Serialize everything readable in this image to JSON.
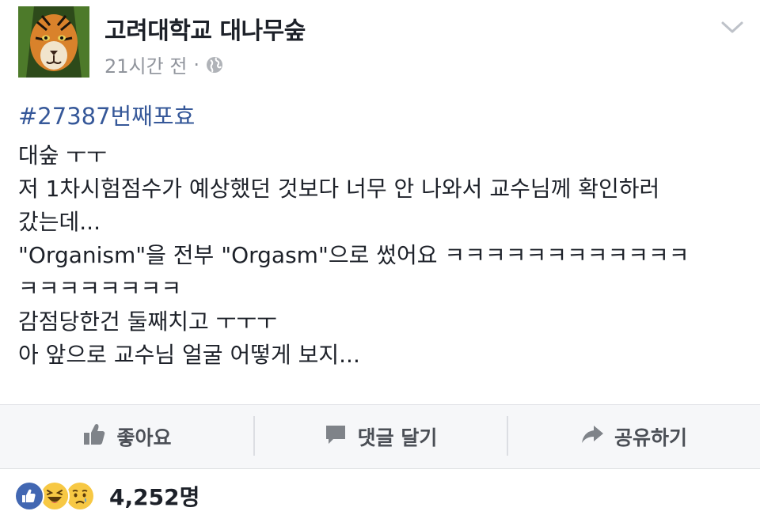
{
  "post": {
    "page_name": "고려대학교 대나무숲",
    "timestamp": "21시간 전",
    "separator": "·",
    "hashtag": "#27387번째포효",
    "body_lines": [
      "대숲 ㅜㅜ",
      "저 1차시험점수가 예상했던 것보다 너무 안 나와서 교수님께 확인하러",
      "갔는데...",
      "\"Organism\"을 전부 \"Orgasm\"으로 썼어요 ㅋㅋㅋㅋㅋㅋㅋㅋㅋㅋㅋㅋ",
      "ㅋㅋㅋㅋㅋㅋㅋㅋ",
      "감점당한건 둘째치고 ㅜㅜㅜ",
      "아 앞으로 교수님 얼굴 어떻게 보지..."
    ]
  },
  "actions": {
    "like_label": "좋아요",
    "comment_label": "댓글 달기",
    "share_label": "공유하기"
  },
  "reactions": {
    "icons": [
      "like-icon",
      "haha-icon",
      "sad-icon"
    ],
    "count": "4,252명"
  },
  "colors": {
    "hashtag": "#365899",
    "meta": "#90949c",
    "action_bar": "#f6f7f9",
    "like_blue": "#4267b2",
    "emoji_yellow": "#f7c844"
  }
}
